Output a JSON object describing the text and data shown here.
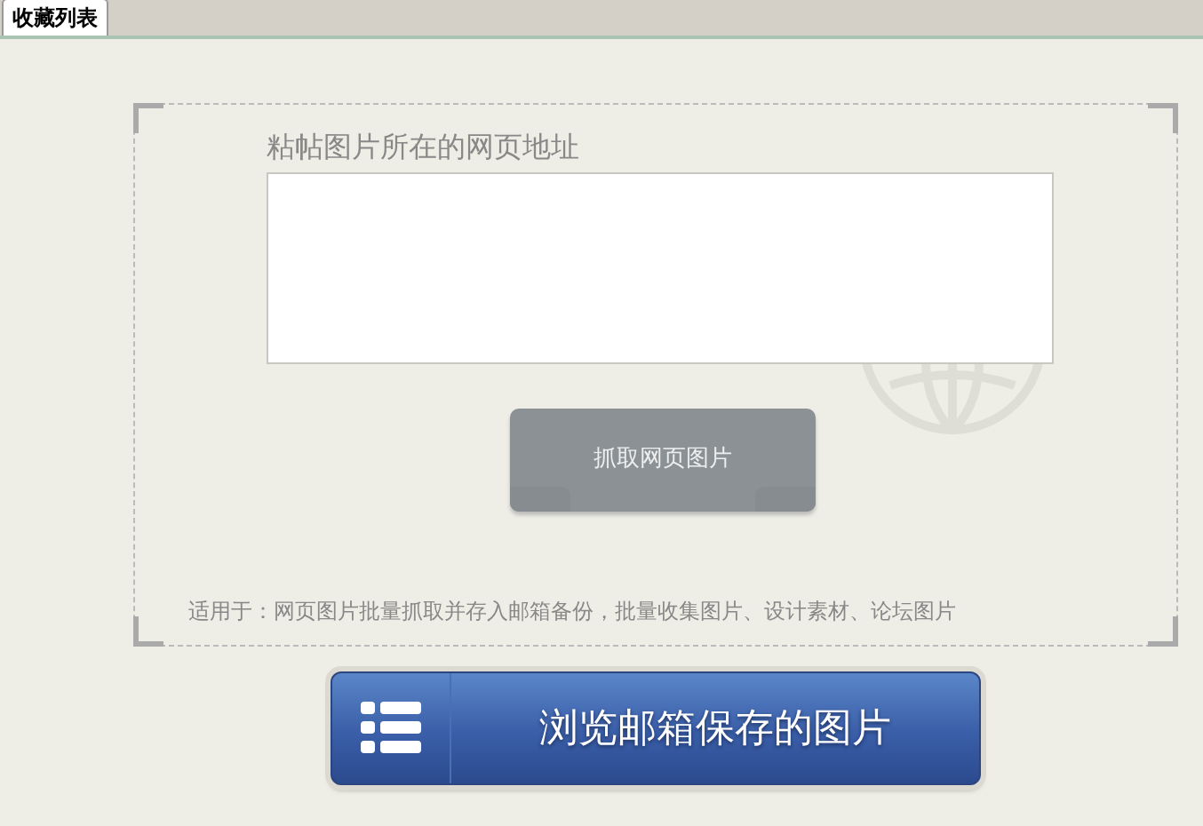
{
  "tabs": [
    {
      "label": "收藏列表",
      "selected": true
    }
  ],
  "url_field": {
    "label": "粘帖图片所在的网页地址"
  },
  "grab_button": {
    "label": "抓取网页图片",
    "disabled": true
  },
  "note": "适用于：网页图片批量抓取并存入邮箱备份，批量收集图片、设计素材、论坛图片",
  "browse_button": {
    "label": "浏览邮箱保存的图片"
  }
}
